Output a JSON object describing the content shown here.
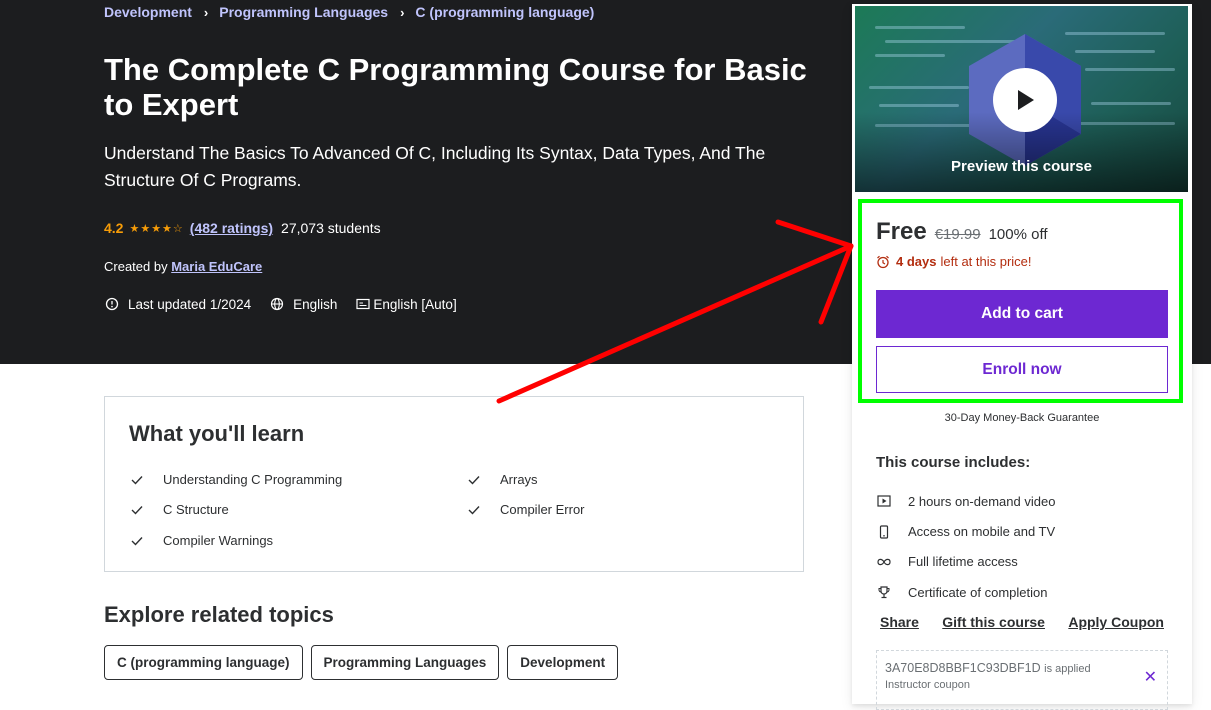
{
  "breadcrumb": [
    "Development",
    "Programming Languages",
    "C (programming language)"
  ],
  "course": {
    "title": "The Complete C Programming Course for Basic to Expert",
    "subtitle": "Understand The Basics To Advanced Of C, Including Its Syntax, Data Types, And The Structure Of C Programs.",
    "rating": "4.2",
    "stars": "★★★★☆",
    "ratings_count": "(482 ratings)",
    "students": "27,073 students",
    "created_by_label": "Created by",
    "instructor": "Maria EduCare",
    "last_updated": "Last updated 1/2024",
    "language": "English",
    "captions": "English [Auto]"
  },
  "sidebar": {
    "preview_label": "Preview this course",
    "price": "Free",
    "original_price": "€19.99",
    "discount": "100% off",
    "timer_days": "4 days",
    "timer_text": "left at this price!",
    "add_to_cart": "Add to cart",
    "enroll_now": "Enroll now",
    "guarantee": "30-Day Money-Back Guarantee",
    "includes_title": "This course includes:",
    "includes": [
      {
        "icon": "video-icon",
        "text": "2 hours on-demand video"
      },
      {
        "icon": "mobile-icon",
        "text": "Access on mobile and TV"
      },
      {
        "icon": "infinity-icon",
        "text": "Full lifetime access"
      },
      {
        "icon": "trophy-icon",
        "text": "Certificate of completion"
      }
    ],
    "links": [
      "Share",
      "Gift this course",
      "Apply Coupon"
    ],
    "coupon_code": "3A70E8D8BBF1C93DBF1D",
    "coupon_applied": "is applied",
    "coupon_type": "Instructor coupon"
  },
  "learn": {
    "title": "What you'll learn",
    "items": [
      "Understanding C Programming",
      "Arrays",
      "C Structure",
      "Compiler Error",
      "Compiler Warnings"
    ]
  },
  "topics": {
    "title": "Explore related topics",
    "items": [
      "C (programming language)",
      "Programming Languages",
      "Development"
    ]
  },
  "colors": {
    "hero_bg": "#1c1d1f",
    "accent": "#6d28d2",
    "link_light": "#c0c4fc",
    "star": "#f69c08",
    "annotation_box": "#00ff00",
    "annotation_arrow": "#ff0000"
  }
}
